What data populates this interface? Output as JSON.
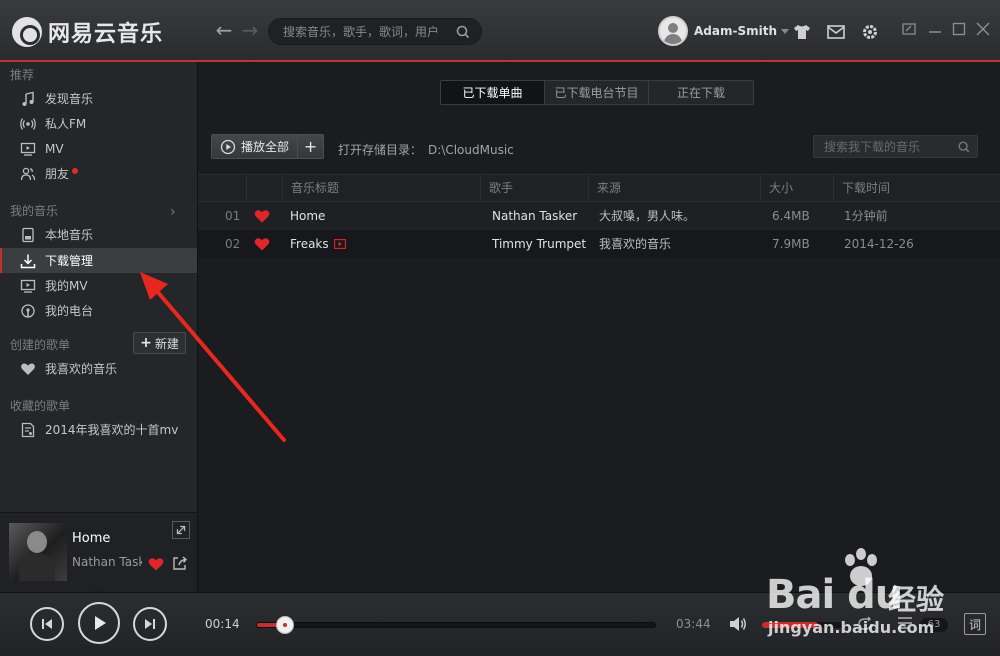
{
  "app": {
    "name": "网易云音乐"
  },
  "header": {
    "search_placeholder": "搜索音乐，歌手，歌词，用户",
    "username": "Adam-Smith"
  },
  "sidebar": {
    "sections": {
      "recommend": "推荐",
      "my_music": "我的音乐",
      "created_playlists": "创建的歌单",
      "collected_playlists": "收藏的歌单"
    },
    "recommend_items": [
      {
        "label": "发现音乐",
        "icon": "music-note-icon"
      },
      {
        "label": "私人FM",
        "icon": "radio-signal-icon"
      },
      {
        "label": "MV",
        "icon": "mv-screen-icon"
      },
      {
        "label": "朋友",
        "icon": "friends-icon"
      }
    ],
    "my_music_items": [
      {
        "label": "本地音乐",
        "icon": "local-device-icon"
      },
      {
        "label": "下载管理",
        "icon": "download-icon",
        "active": true
      },
      {
        "label": "我的MV",
        "icon": "mv-screen-icon"
      },
      {
        "label": "我的电台",
        "icon": "radio-station-icon"
      }
    ],
    "new_playlist_label": "新建",
    "created_items": [
      {
        "label": "我喜欢的音乐",
        "icon": "heart-icon"
      }
    ],
    "collected_items": [
      {
        "label": "2014年我喜欢的十首mv",
        "icon": "playlist-icon"
      }
    ]
  },
  "now_playing": {
    "title": "Home",
    "artist": "Nathan Tasker"
  },
  "main": {
    "tabs": [
      {
        "label": "已下载单曲",
        "active": true
      },
      {
        "label": "已下载电台节目",
        "active": false
      },
      {
        "label": "正在下载",
        "active": false
      }
    ],
    "play_all_label": "播放全部",
    "add_label": "+",
    "open_dir_label": "打开存储目录：",
    "open_dir_path": "D:\\CloudMusic",
    "local_search_placeholder": "搜索我下载的音乐",
    "columns": [
      "音乐标题",
      "歌手",
      "来源",
      "大小",
      "下载时间"
    ],
    "rows": [
      {
        "index": "01",
        "title": "Home",
        "has_mv": false,
        "artist": "Nathan Tasker",
        "source": "大叔嗓，男人味。",
        "size": "6.4MB",
        "time": "1分钟前"
      },
      {
        "index": "02",
        "title": "Freaks",
        "has_mv": true,
        "artist": "Timmy Trumpet",
        "source": "我喜欢的音乐",
        "size": "7.9MB",
        "time": "2014-12-26"
      }
    ]
  },
  "player": {
    "current_time": "00:14",
    "total_time": "03:44",
    "progress": 0.07,
    "volume": 0.7,
    "playlist_count": "63",
    "lyric_label": "词"
  },
  "watermark": {
    "brand": "Bai du",
    "cn": "经验",
    "url": "jingyan.baidu.com"
  },
  "colors": {
    "accent": "#c62f2f",
    "background": "#1b1c20",
    "sidebar": "#25262a"
  }
}
